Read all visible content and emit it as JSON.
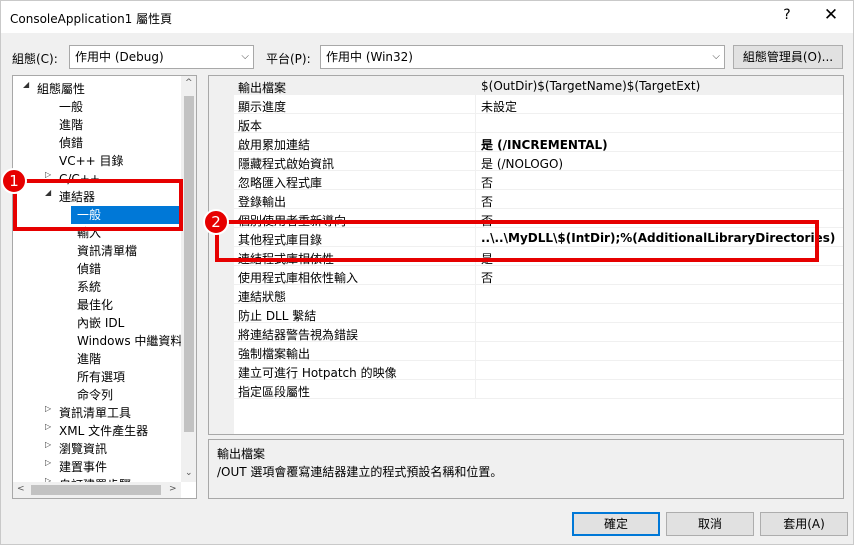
{
  "window": {
    "title": "ConsoleApplication1 屬性頁",
    "help_label": "?",
    "close_label": "✕"
  },
  "config": {
    "label": "組態(C):",
    "value": "作用中 (Debug)",
    "platform_label": "平台(P):",
    "platform_value": "作用中 (Win32)",
    "manager_button": "組態管理員(O)..."
  },
  "tree": {
    "items": [
      {
        "label": "組態屬性",
        "arrow": "◢"
      },
      {
        "label": "一般"
      },
      {
        "label": "進階"
      },
      {
        "label": "偵錯"
      },
      {
        "label": "VC++ 目錄"
      },
      {
        "label": "C/C++",
        "arrow": "▷"
      },
      {
        "label": "連結器",
        "arrow": "◢"
      },
      {
        "label": "一般"
      },
      {
        "label": "輸入"
      },
      {
        "label": "資訊清單檔"
      },
      {
        "label": "偵錯"
      },
      {
        "label": "系統"
      },
      {
        "label": "最佳化"
      },
      {
        "label": "內嵌 IDL"
      },
      {
        "label": "Windows 中繼資料"
      },
      {
        "label": "進階"
      },
      {
        "label": "所有選項"
      },
      {
        "label": "命令列"
      },
      {
        "label": "資訊清單工具",
        "arrow": "▷"
      },
      {
        "label": "XML 文件產生器",
        "arrow": "▷"
      },
      {
        "label": "瀏覽資訊",
        "arrow": "▷"
      },
      {
        "label": "建置事件",
        "arrow": "▷"
      },
      {
        "label": "自訂建置步驟",
        "arrow": "▷"
      }
    ]
  },
  "properties": [
    {
      "name": "輸出檔案",
      "value": "$(OutDir)$(TargetName)$(TargetExt)",
      "bold": false
    },
    {
      "name": "顯示進度",
      "value": "未設定",
      "bold": false
    },
    {
      "name": "版本",
      "value": "",
      "bold": false
    },
    {
      "name": "啟用累加連結",
      "value": "是 (/INCREMENTAL)",
      "bold": true
    },
    {
      "name": "隱藏程式啟始資訊",
      "value": "是 (/NOLOGO)",
      "bold": false
    },
    {
      "name": "忽略匯入程式庫",
      "value": "否",
      "bold": false
    },
    {
      "name": "登錄輸出",
      "value": "否",
      "bold": false
    },
    {
      "name": "個別使用者重新導向",
      "value": "否",
      "bold": false
    },
    {
      "name": "其他程式庫目錄",
      "value": "..\\..\\MyDLL\\$(IntDir);%(AdditionalLibraryDirectories)",
      "bold": true
    },
    {
      "name": "連結程式庫相依性",
      "value": "是",
      "bold": false
    },
    {
      "name": "使用程式庫相依性輸入",
      "value": "否",
      "bold": false
    },
    {
      "name": "連結狀態",
      "value": "",
      "bold": false
    },
    {
      "name": "防止 DLL 繫結",
      "value": "",
      "bold": false
    },
    {
      "name": "將連結器警告視為錯誤",
      "value": "",
      "bold": false
    },
    {
      "name": "強制檔案輸出",
      "value": "",
      "bold": false
    },
    {
      "name": "建立可進行 Hotpatch 的映像",
      "value": "",
      "bold": false
    },
    {
      "name": "指定區段屬性",
      "value": "",
      "bold": false
    }
  ],
  "description": {
    "title": "輸出檔案",
    "text": "/OUT 選項會覆寫連結器建立的程式預設名稱和位置。"
  },
  "buttons": {
    "ok": "確定",
    "cancel": "取消",
    "apply": "套用(A)"
  },
  "annotations": {
    "badge1": "1",
    "badge2": "2",
    "color": "#e60000"
  },
  "colors": {
    "selection": "#0078d7",
    "dialog_bg": "#f0f0f0"
  }
}
